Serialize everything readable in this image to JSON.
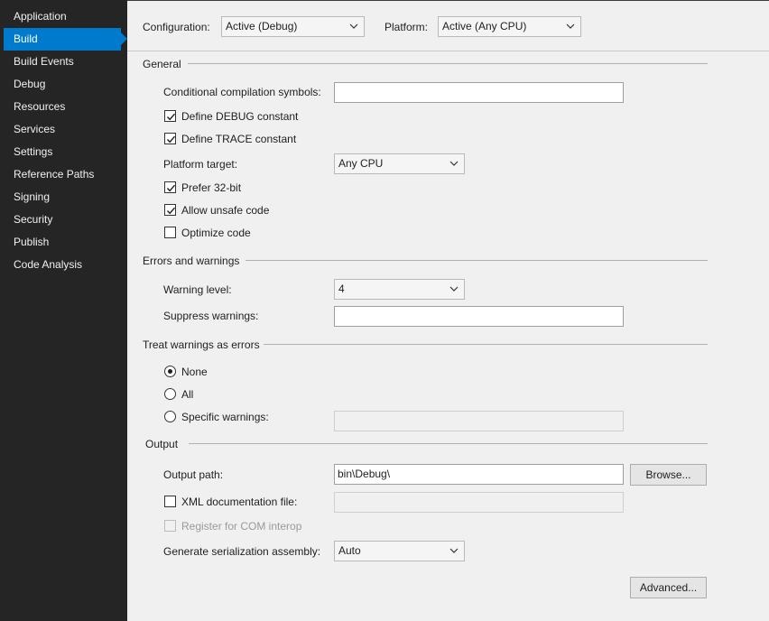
{
  "sidebar": {
    "items": [
      {
        "label": "Application"
      },
      {
        "label": "Build"
      },
      {
        "label": "Build Events"
      },
      {
        "label": "Debug"
      },
      {
        "label": "Resources"
      },
      {
        "label": "Services"
      },
      {
        "label": "Settings"
      },
      {
        "label": "Reference Paths"
      },
      {
        "label": "Signing"
      },
      {
        "label": "Security"
      },
      {
        "label": "Publish"
      },
      {
        "label": "Code Analysis"
      }
    ],
    "active_index": 1
  },
  "toolbar": {
    "configuration_label": "Configuration:",
    "configuration_value": "Active (Debug)",
    "platform_label": "Platform:",
    "platform_value": "Active (Any CPU)"
  },
  "general": {
    "title": "General",
    "conditional_symbols_label": "Conditional compilation symbols:",
    "conditional_symbols_value": "",
    "define_debug_label": "Define DEBUG constant",
    "define_debug_checked": true,
    "define_trace_label": "Define TRACE constant",
    "define_trace_checked": true,
    "platform_target_label": "Platform target:",
    "platform_target_value": "Any CPU",
    "prefer32_label": "Prefer 32-bit",
    "prefer32_checked": true,
    "allow_unsafe_label": "Allow unsafe code",
    "allow_unsafe_checked": true,
    "optimize_label": "Optimize code",
    "optimize_checked": false
  },
  "errors": {
    "title": "Errors and warnings",
    "warning_level_label": "Warning level:",
    "warning_level_value": "4",
    "suppress_label": "Suppress warnings:",
    "suppress_value": ""
  },
  "treat": {
    "title": "Treat warnings as errors",
    "none_label": "None",
    "all_label": "All",
    "specific_label": "Specific warnings:",
    "selected": "None",
    "specific_value": ""
  },
  "output": {
    "title": "Output",
    "path_label": "Output path:",
    "path_value": "bin\\Debug\\",
    "browse_label": "Browse...",
    "xml_doc_label": "XML documentation file:",
    "xml_doc_checked": false,
    "xml_doc_value": "",
    "com_interop_label": "Register for COM interop",
    "com_interop_checked": false,
    "serialization_label": "Generate serialization assembly:",
    "serialization_value": "Auto",
    "advanced_label": "Advanced..."
  },
  "colors": {
    "sidebar_bg": "#252526",
    "active_item": "#007acc",
    "content_bg": "#f0f0f0"
  }
}
